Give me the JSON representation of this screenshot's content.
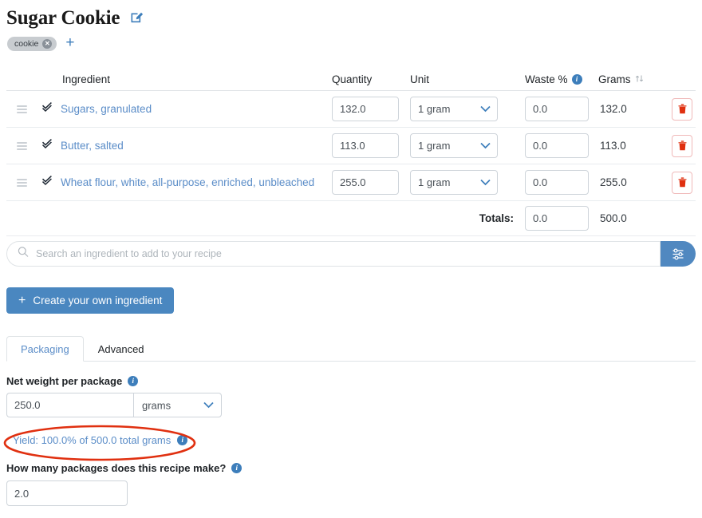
{
  "header": {
    "title": "Sugar Cookie",
    "edit_icon": "pencil-square-icon",
    "tags": [
      {
        "label": "cookie",
        "remove_icon": "close-icon"
      }
    ],
    "add_tag_label": "+"
  },
  "table": {
    "columns": {
      "ingredient": "Ingredient",
      "quantity": "Quantity",
      "unit": "Unit",
      "waste": "Waste %",
      "waste_info_icon": "info-icon",
      "grams": "Grams",
      "sort_icon": "sort-updown-icon"
    },
    "rows": [
      {
        "handle_icon": "drag-handle-icon",
        "check_icon": "double-check-icon",
        "name": "Sugars, granulated",
        "quantity": "132.0",
        "unit": "1 gram",
        "waste": "0.0",
        "grams": "132.0",
        "delete_icon": "trash-icon"
      },
      {
        "handle_icon": "drag-handle-icon",
        "check_icon": "double-check-icon",
        "name": "Butter, salted",
        "quantity": "113.0",
        "unit": "1 gram",
        "waste": "0.0",
        "grams": "113.0",
        "delete_icon": "trash-icon"
      },
      {
        "handle_icon": "drag-handle-icon",
        "check_icon": "double-check-icon",
        "name": "Wheat flour, white, all-purpose, enriched, unbleached",
        "quantity": "255.0",
        "unit": "1 gram",
        "waste": "0.0",
        "grams": "255.0",
        "delete_icon": "trash-icon"
      }
    ],
    "totals": {
      "label": "Totals:",
      "waste": "0.0",
      "grams": "500.0"
    }
  },
  "search": {
    "placeholder": "Search an ingredient to add to your recipe",
    "value": "",
    "icon": "search-icon",
    "filter_icon": "sliders-icon"
  },
  "create_button": {
    "plus": "+",
    "label": "Create your own ingredient"
  },
  "tabs": [
    {
      "label": "Packaging",
      "active": true
    },
    {
      "label": "Advanced",
      "active": false
    }
  ],
  "packaging": {
    "net_weight_label": "Net weight per package",
    "net_weight_info_icon": "info-icon",
    "net_weight_value": "250.0",
    "net_weight_unit": "grams",
    "unit_chevron_icon": "chevron-down-icon",
    "yield_text": "Yield: 100.0% of 500.0 total grams",
    "yield_info_icon": "info-icon",
    "packages_label": "How many packages does this recipe make?",
    "packages_info_icon": "info-icon",
    "packages_value": "2.0"
  },
  "annotation": {
    "shape": "ellipse-highlight",
    "color": "#e03010"
  },
  "colors": {
    "accent": "#4a87c0",
    "link": "#5b8dc8",
    "danger": "#e03010",
    "info": "#3d7ebb"
  }
}
